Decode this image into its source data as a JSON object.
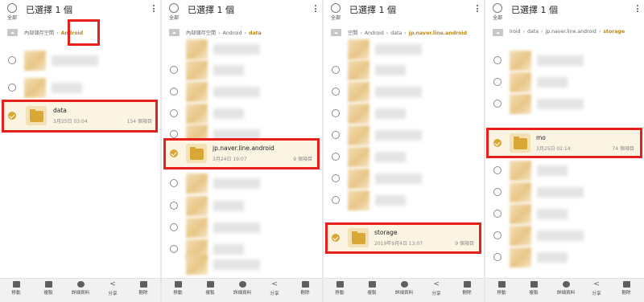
{
  "accent_color": "#d9a735",
  "highlight_color": "#e8201c",
  "common": {
    "title": "已選擇 1 個",
    "select_all": "全部",
    "more_icon": "more-vert-icon",
    "home_icon": "storage-home-icon",
    "bottom_actions": [
      {
        "label": "移動",
        "icon": "move-icon"
      },
      {
        "label": "複製",
        "icon": "copy-icon"
      },
      {
        "label": "詳細資料",
        "icon": "info-icon"
      },
      {
        "label": "分享",
        "icon": "share-icon"
      },
      {
        "label": "刪除",
        "icon": "delete-icon"
      }
    ]
  },
  "panels": [
    {
      "breadcrumb": [
        "內部儲存空間",
        "Android"
      ],
      "selected": {
        "name": "data",
        "date": "3月25日 03:04",
        "count": "154 個項目"
      }
    },
    {
      "breadcrumb": [
        "內部儲存空間",
        "Android",
        "data"
      ],
      "selected": {
        "name": "jp.naver.line.android",
        "date": "3月24日 19:07",
        "count": "9 個項目"
      }
    },
    {
      "breadcrumb": [
        "空間",
        "Android",
        "data",
        "jp.naver.line.android"
      ],
      "selected": {
        "name": "storage",
        "date": "2019年9月4日 13:07",
        "count": "9 個項目"
      }
    },
    {
      "breadcrumb": [
        "lroid",
        "data",
        "jp.naver.line.android",
        "storage"
      ],
      "selected": {
        "name": "mo",
        "date": "3月25日 02:14",
        "count": "74 個項目"
      }
    }
  ]
}
